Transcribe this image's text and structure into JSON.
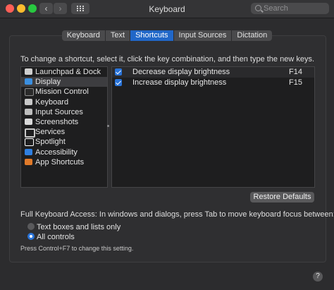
{
  "window": {
    "title": "Keyboard"
  },
  "search": {
    "placeholder": "Search"
  },
  "tabs": [
    {
      "label": "Keyboard",
      "active": false
    },
    {
      "label": "Text",
      "active": false
    },
    {
      "label": "Shortcuts",
      "active": true
    },
    {
      "label": "Input Sources",
      "active": false
    },
    {
      "label": "Dictation",
      "active": false
    }
  ],
  "instructions": "To change a shortcut, select it, click the key combination, and then type the new keys.",
  "categories": [
    {
      "label": "Launchpad & Dock",
      "icon": "launchpad-icon"
    },
    {
      "label": "Display",
      "icon": "display-icon",
      "selected": true
    },
    {
      "label": "Mission Control",
      "icon": "mission-control-icon"
    },
    {
      "label": "Keyboard",
      "icon": "keyboard-icon"
    },
    {
      "label": "Input Sources",
      "icon": "input-sources-icon"
    },
    {
      "label": "Screenshots",
      "icon": "screenshots-icon"
    },
    {
      "label": "Services",
      "icon": "services-gear-icon"
    },
    {
      "label": "Spotlight",
      "icon": "spotlight-icon"
    },
    {
      "label": "Accessibility",
      "icon": "accessibility-icon"
    },
    {
      "label": "App Shortcuts",
      "icon": "app-shortcuts-icon"
    }
  ],
  "shortcuts": [
    {
      "name": "Decrease display brightness",
      "key": "F14",
      "checked": true
    },
    {
      "name": "Increase display brightness",
      "key": "F15",
      "checked": true
    }
  ],
  "restore_button": "Restore Defaults",
  "full_keyboard_access": {
    "label": "Full Keyboard Access: In windows and dialogs, press Tab to move keyboard focus between:",
    "options": [
      {
        "label": "Text boxes and lists only",
        "selected": false
      },
      {
        "label": "All controls",
        "selected": true
      }
    ],
    "hint": "Press Control+F7 to change this setting."
  },
  "help_button": "?",
  "nav": {
    "back": "‹",
    "forward": "›"
  },
  "colors": {
    "accent": "#2167c8",
    "close": "#ff5f57",
    "minimize": "#febc2e",
    "zoom": "#28c840"
  }
}
